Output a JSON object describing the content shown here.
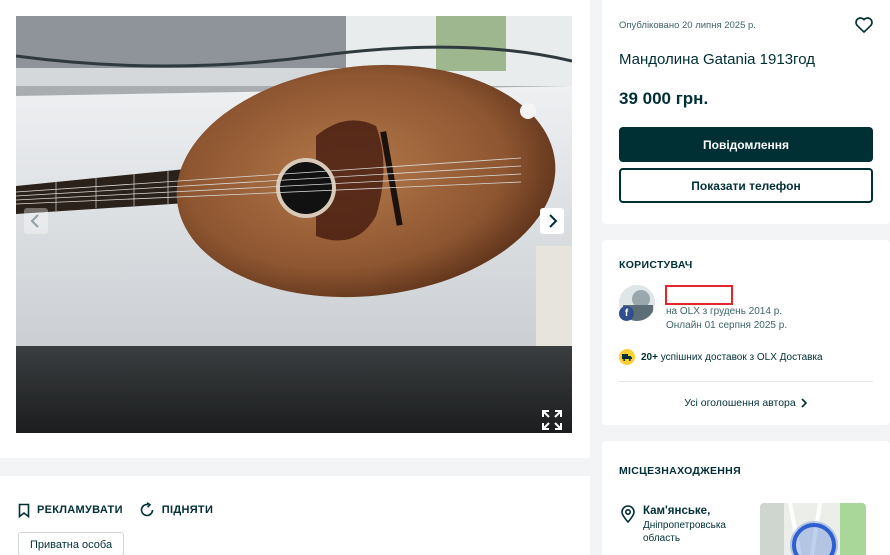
{
  "listing": {
    "published": "Опубліковано 20 липня 2025 р.",
    "title": "Мандолина Gatania 1913год",
    "price": "39 000 грн.",
    "message_button": "Повідомлення",
    "phone_button": "Показати телефон"
  },
  "actions": {
    "promote_label": "РЕКЛАМУВАТИ",
    "raise_label": "ПІДНЯТИ",
    "seller_type": "Приватна особа"
  },
  "user": {
    "section_title": "КОРИСТУВАЧ",
    "member_since": "на OLX з грудень 2014 р.",
    "last_online": "Онлайн 01 серпня 2025 р.",
    "delivery_count": "20+",
    "delivery_text": "успішних доставок з OLX Доставка",
    "all_ads_link": "Усі оголошення автора"
  },
  "location": {
    "section_title": "МІСЦЕЗНАХОДЖЕННЯ",
    "city": "Кам'янське,",
    "region": "Дніпропетровська область"
  },
  "icons": {
    "favorite": "heart-icon",
    "prev": "chevron-left-icon",
    "next": "chevron-right-icon",
    "fullscreen": "expand-icon",
    "promote": "bookmark-icon",
    "raise": "refresh-icon",
    "delivery": "truck-icon",
    "location": "pin-icon",
    "facebook": "facebook-icon"
  },
  "colors": {
    "primary": "#002f34",
    "background": "#f2f4f5",
    "delivery_badge": "#ffce32",
    "redaction_box": "#e4262c"
  }
}
